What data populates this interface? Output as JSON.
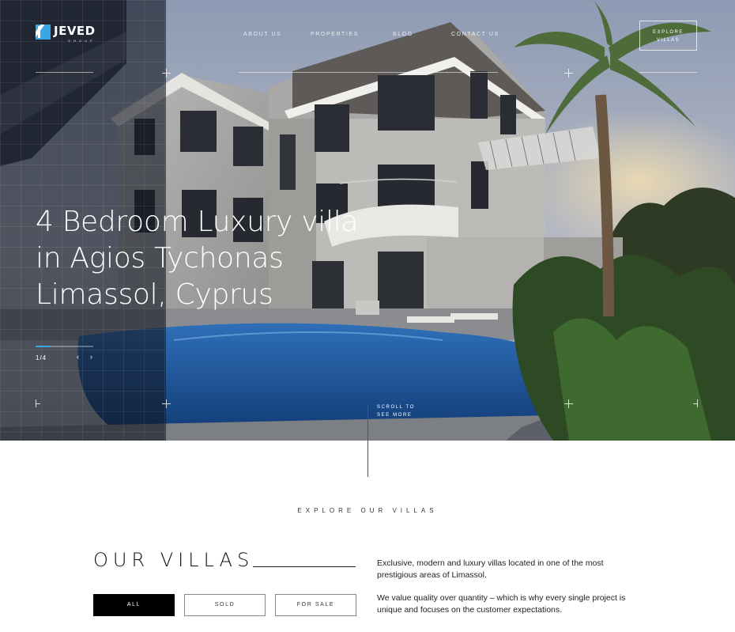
{
  "colors": {
    "accent": "#3aa6e6",
    "dark_panel": "#121622",
    "button_active_bg": "#000000",
    "text": "#111111"
  },
  "brand": {
    "name": "JEVED",
    "sub": "GROUP",
    "icon": "jeved-logo-mark"
  },
  "nav": {
    "items": [
      "ABOUT US",
      "PROPERTIES",
      "BLOG",
      "CONTACT US"
    ],
    "cta": [
      "EXPLORE",
      "VILLAS"
    ]
  },
  "hero": {
    "title_lines": [
      "4 Bedroom Luxury villa",
      "in Agios Tychonas",
      "Limassol, Cyprus"
    ],
    "slide_counter": "1/4",
    "slide_progress": 0.25,
    "prev_icon": "‹",
    "next_icon": "›",
    "scroll_hint": [
      "SCROLL TO",
      "SEE MORE"
    ],
    "image": "luxury-villa-with-pool-and-palm-trees"
  },
  "villas": {
    "eyebrow": "EXPLORE OUR VILLAS",
    "title": "OUR VILLAS",
    "filters": [
      {
        "label": "ALL",
        "active": true
      },
      {
        "label": "SOLD",
        "active": false
      },
      {
        "label": "FOR SALE",
        "active": false
      }
    ],
    "description": [
      "Exclusive, modern and luxury villas located in one of the most prestigious areas of Limassol.",
      "We value quality over quantity – which is why every single project is unique and focuses on the customer expectations."
    ]
  }
}
